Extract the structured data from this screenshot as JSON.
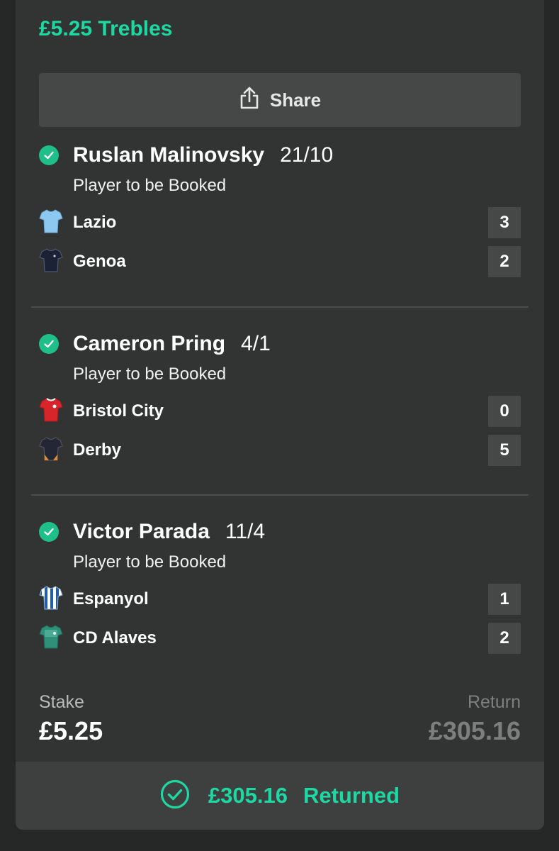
{
  "bet": {
    "title": "£5.25 Trebles",
    "share_label": "Share"
  },
  "selections": [
    {
      "player": "Ruslan Malinovsky",
      "odds": "21/10",
      "market": "Player to be Booked",
      "teams": [
        {
          "name": "Lazio",
          "score": "3",
          "kit": "lazio-kit-icon"
        },
        {
          "name": "Genoa",
          "score": "2",
          "kit": "genoa-kit-icon"
        }
      ]
    },
    {
      "player": "Cameron Pring",
      "odds": "4/1",
      "market": "Player to be Booked",
      "teams": [
        {
          "name": "Bristol City",
          "score": "0",
          "kit": "bristol-city-kit-icon"
        },
        {
          "name": "Derby",
          "score": "5",
          "kit": "derby-kit-icon"
        }
      ]
    },
    {
      "player": "Victor Parada",
      "odds": "11/4",
      "market": "Player to be Booked",
      "teams": [
        {
          "name": "Espanyol",
          "score": "1",
          "kit": "espanyol-kit-icon"
        },
        {
          "name": "CD Alaves",
          "score": "2",
          "kit": "cd-alaves-kit-icon"
        }
      ]
    }
  ],
  "summary": {
    "stake_label": "Stake",
    "stake_value": "£5.25",
    "return_label": "Return",
    "return_value": "£305.16"
  },
  "footer": {
    "amount": "£305.16",
    "status": "Returned"
  },
  "colors": {
    "accent": "#1ed8a4",
    "check": "#1fbf8a",
    "card_bg": "#323433",
    "button_bg": "#454846"
  }
}
